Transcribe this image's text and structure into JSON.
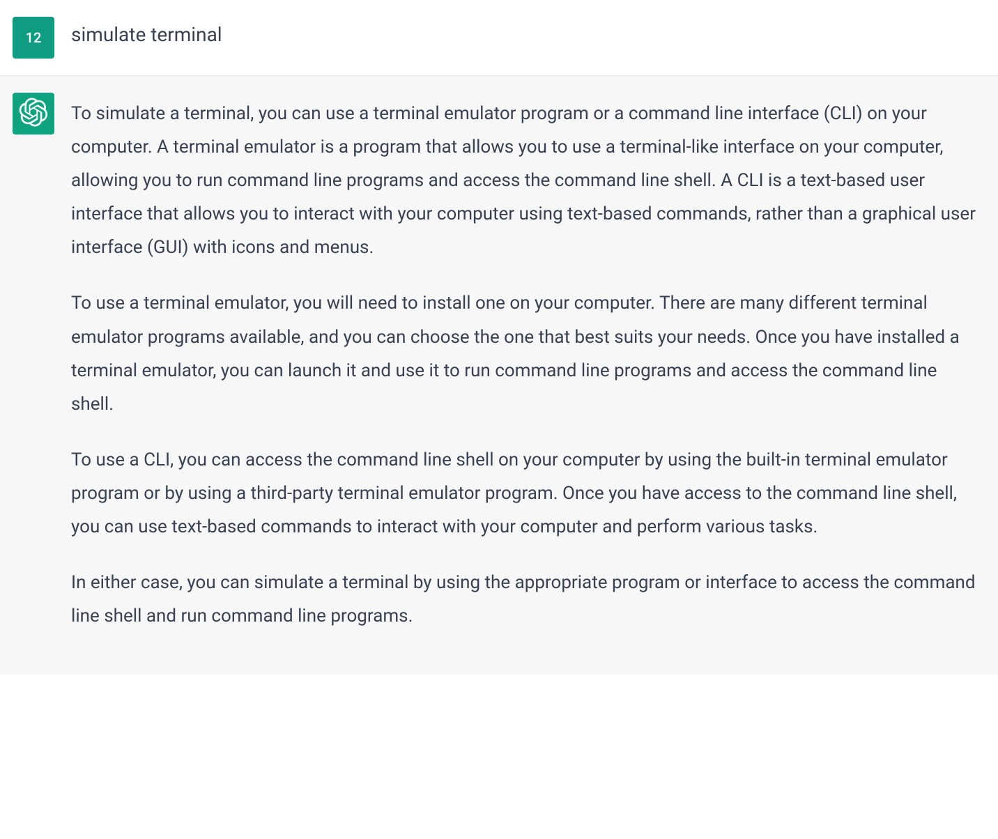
{
  "user": {
    "avatar_label": "12",
    "message": "simulate terminal"
  },
  "assistant": {
    "paragraphs": [
      "To simulate a terminal, you can use a terminal emulator program or a command line interface (CLI) on your computer. A terminal emulator is a program that allows you to use a terminal-like interface on your computer, allowing you to run command line programs and access the command line shell. A CLI is a text-based user interface that allows you to interact with your computer using text-based commands, rather than a graphical user interface (GUI) with icons and menus.",
      "To use a terminal emulator, you will need to install one on your computer. There are many different terminal emulator programs available, and you can choose the one that best suits your needs. Once you have installed a terminal emulator, you can launch it and use it to run command line programs and access the command line shell.",
      "To use a CLI, you can access the command line shell on your computer by using the built-in terminal emulator program or by using a third-party terminal emulator program. Once you have access to the command line shell, you can use text-based commands to interact with your computer and perform various tasks.",
      "In either case, you can simulate a terminal by using the appropriate program or interface to access the command line shell and run command line programs."
    ]
  }
}
